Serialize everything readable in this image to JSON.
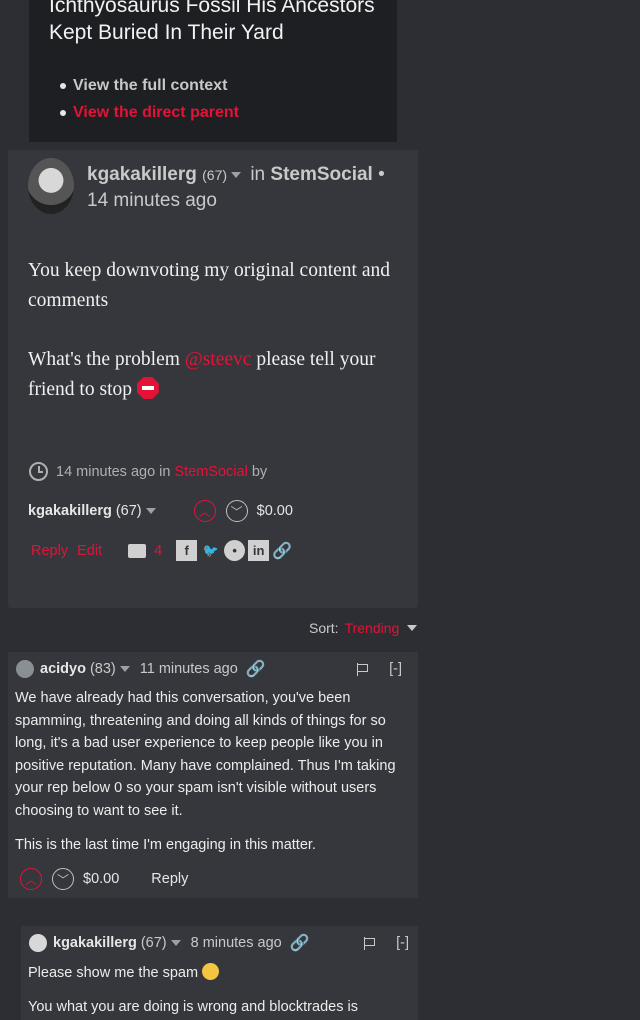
{
  "parent": {
    "title": "Ichthyosaurus Fossil His Ancestors Kept Buried In Their Yard",
    "links": [
      "View the full context",
      "View the direct parent"
    ]
  },
  "post": {
    "author": "kgakakillerg",
    "reputation": "(67)",
    "in_word": "in",
    "community": "StemSocial",
    "time": "• 14 minutes ago",
    "body_p1": "You keep downvoting my original content and comments",
    "body_p2_pre": "What's the problem ",
    "body_p2_mention": "@steevc",
    "body_p2_post": " please tell your friend to stop",
    "footer_time": "14 minutes ago in",
    "footer_community": "StemSocial",
    "footer_by": "by",
    "footer_author": "kgakakillerg",
    "footer_rep": "(67)",
    "payout": "$0.00",
    "reply_label": "Reply",
    "edit_label": "Edit",
    "comment_count": "4"
  },
  "sort": {
    "label": "Sort:",
    "value": "Trending"
  },
  "comment1": {
    "author": "acidyo",
    "reputation": "(83)",
    "time": "11 minutes ago",
    "hide": "[-]",
    "body_p1": "We have already had this conversation, you've been spamming, threatening and doing all kinds of things for so long, it's a bad user experience to keep people like you in positive reputation. Many have complained. Thus I'm taking your rep below 0 so your spam isn't visible without users choosing to want to see it.",
    "body_p2": "This is the last time I'm engaging in this matter.",
    "payout": "$0.00",
    "reply_label": "Reply"
  },
  "comment2": {
    "author": "kgakakillerg",
    "reputation": "(67)",
    "time": "8 minutes ago",
    "hide": "[-]",
    "body_p1": "Please show me the spam",
    "body_p2": "You what you are doing is wrong and blocktrades is"
  },
  "colors": {
    "accent": "#e31337",
    "background": "#2c2e33",
    "card": "#35373c"
  }
}
